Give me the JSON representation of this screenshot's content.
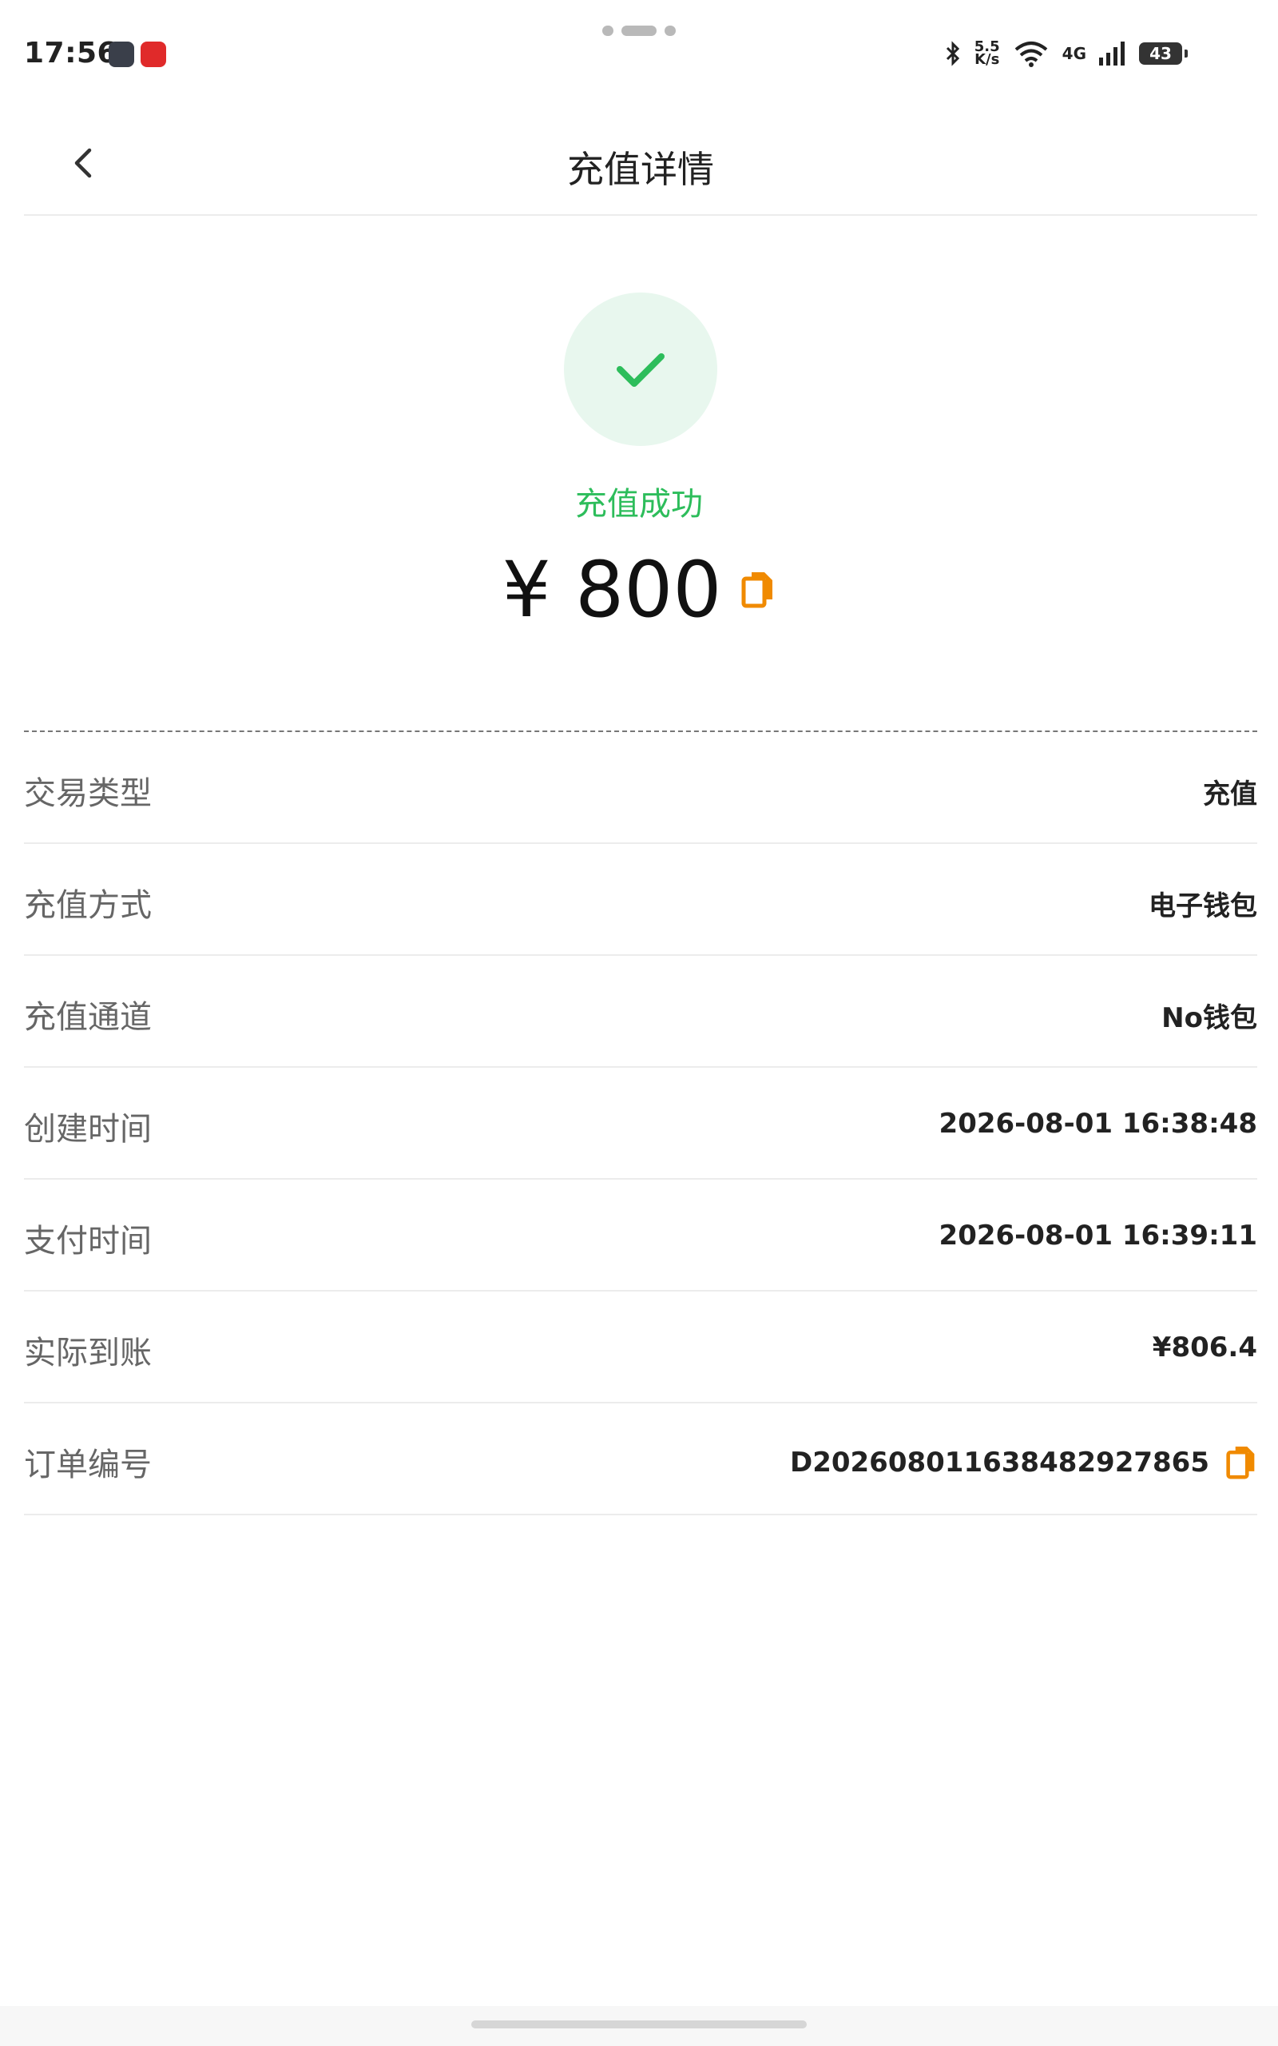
{
  "status_bar": {
    "time": "17:56",
    "net_speed_top": "5.5",
    "net_speed_bottom": "K/s",
    "wifi_gen": "6",
    "cell": "4G",
    "battery": "43"
  },
  "header": {
    "title": "充值详情",
    "back_icon": "chevron-left-icon"
  },
  "result": {
    "status_text": "充值成功",
    "amount": "¥ 800",
    "check_icon": "check-icon",
    "copy_icon": "copy-icon",
    "accent_color": "#2dbd5b",
    "copy_color": "#f08a00"
  },
  "details": [
    {
      "label": "交易类型",
      "value": "充值"
    },
    {
      "label": "充值方式",
      "value": "电子钱包"
    },
    {
      "label": "充值通道",
      "value": "No钱包"
    },
    {
      "label": "创建时间",
      "value": "2026-08-01 16:38:48"
    },
    {
      "label": "支付时间",
      "value": "2026-08-01 16:39:11"
    },
    {
      "label": "实际到账",
      "value": "¥806.4"
    },
    {
      "label": "订单编号",
      "value": "D202608011638482927865",
      "copyable": true
    }
  ]
}
